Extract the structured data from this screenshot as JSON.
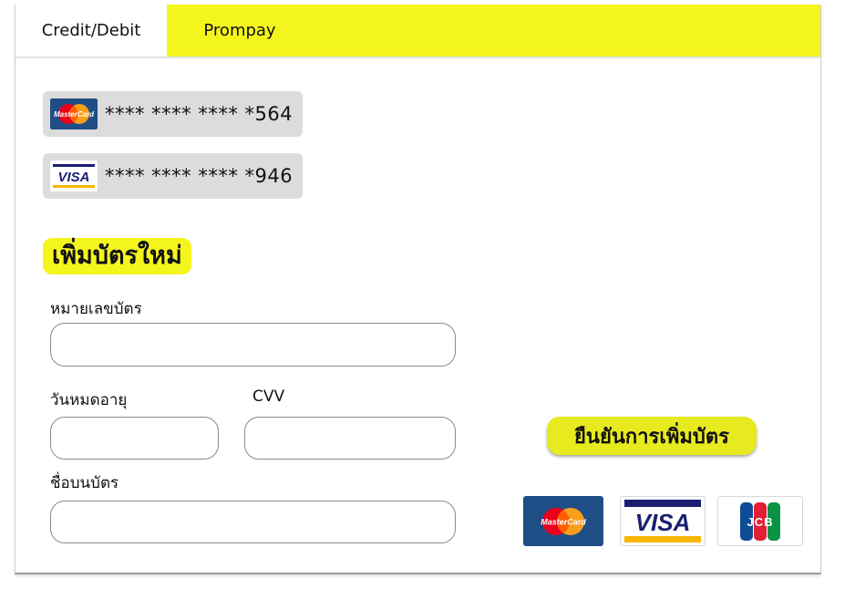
{
  "tabs": [
    {
      "label": "Credit/Debit",
      "active": true
    },
    {
      "label": "Prompay",
      "active": false
    }
  ],
  "saved_cards": [
    {
      "brand": "mastercard",
      "icon": "mastercard-logo-icon",
      "masked_number": "**** **** **** *564"
    },
    {
      "brand": "visa",
      "icon": "visa-logo-icon",
      "masked_number": "**** **** **** *946"
    }
  ],
  "new_card": {
    "title": "เพิ่มบัตรใหม่",
    "card_number_label": "หมายเลขบัตร",
    "card_number_value": "",
    "expiry_label": "วันหมดอายุ",
    "expiry_value": "",
    "cvv_label": "CVV",
    "cvv_value": "",
    "name_label": "ชื่อบนบัตร",
    "name_value": "",
    "confirm_label": "ยืนยันการเพิ่มบัตร"
  },
  "accepted_brands": [
    {
      "brand": "mastercard",
      "icon": "mastercard-logo-icon",
      "text": "MasterCard"
    },
    {
      "brand": "visa",
      "icon": "visa-logo-icon",
      "text": "VISA"
    },
    {
      "brand": "jcb",
      "icon": "jcb-logo-icon",
      "text": "JCB"
    }
  ],
  "colors": {
    "accent_yellow": "#f5f51e",
    "saved_card_bg": "#dcdcdc",
    "mastercard_navy": "#1f4e87",
    "mastercard_red": "#eb001b",
    "mastercard_orange": "#f79e1b",
    "visa_blue": "#1a1f71",
    "visa_gold": "#f7b600"
  }
}
